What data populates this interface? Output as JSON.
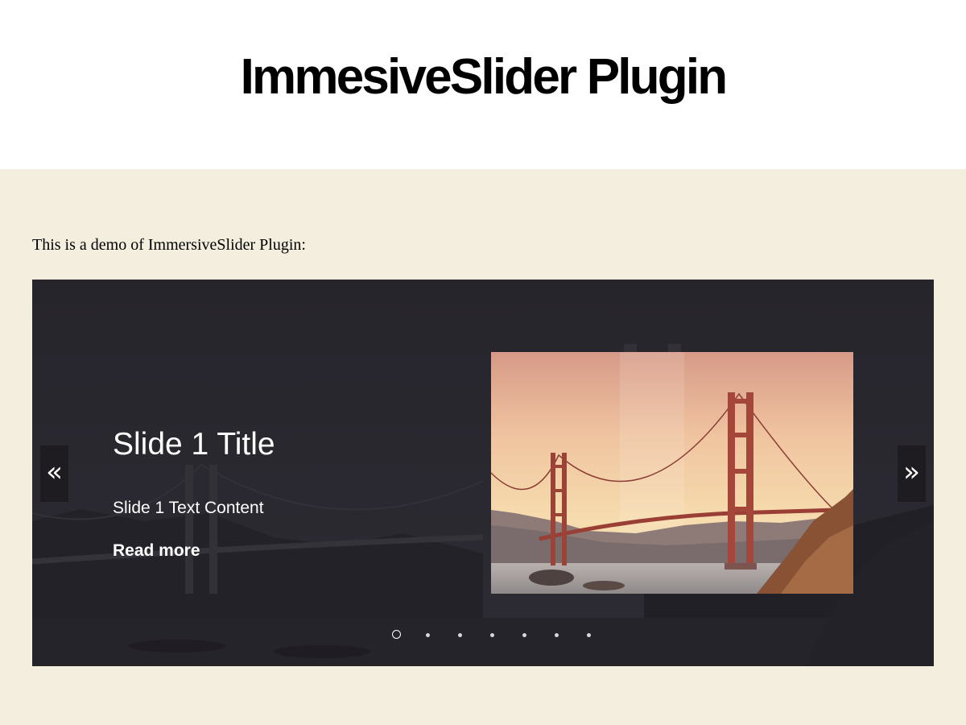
{
  "header": {
    "title": "ImmesiveSlider Plugin"
  },
  "content": {
    "intro": "This is a demo of ImmersiveSlider Plugin:"
  },
  "slider": {
    "current_slide": {
      "title": "Slide 1 Title",
      "text": "Slide 1 Text Content",
      "link_label": "Read more"
    },
    "prev_glyph": "«",
    "next_glyph": "»",
    "slide_count": 7,
    "active_index": 0
  },
  "colors": {
    "content_bg": "#f4eedf",
    "slider_overlay": "#2a2830",
    "bridge_red": "#a4463a"
  }
}
